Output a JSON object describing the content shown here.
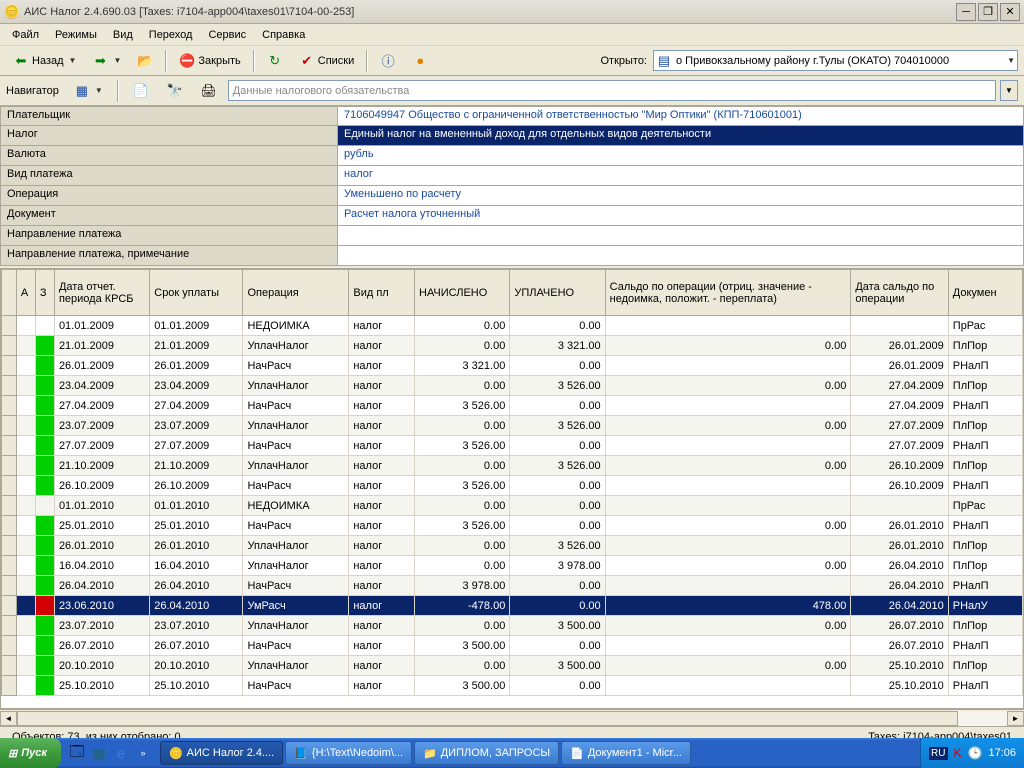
{
  "window": {
    "title": "АИС Налог 2.4.690.03 [Taxes: i7104-app004\\taxes01\\7104-00-253]"
  },
  "menu": [
    "Файл",
    "Режимы",
    "Вид",
    "Переход",
    "Сервис",
    "Справка"
  ],
  "toolbar": {
    "back": "Назад",
    "close": "Закрыть",
    "lists": "Списки",
    "open_label": "Открыто:",
    "open_value": "о Привокзальному району г.Тулы (ОКАТО) 704010000"
  },
  "navigator": {
    "label": "Навигатор",
    "placeholder": "Данные налогового обязательства"
  },
  "form": {
    "rows": [
      {
        "label": "Плательщик",
        "value": "7106049947   Общество с ограниченной ответственностью \"Мир Оптики\" (КПП-710601001)",
        "hl": false
      },
      {
        "label": "Налог",
        "value": "Единый налог на вмененный доход для отдельных видов деятельности",
        "hl": true
      },
      {
        "label": "Валюта",
        "value": "рубль",
        "hl": false
      },
      {
        "label": "Вид платежа",
        "value": "налог",
        "hl": false
      },
      {
        "label": "Операция",
        "value": "Уменьшено по расчету",
        "hl": false
      },
      {
        "label": "Документ",
        "value": "Расчет налога уточненный",
        "hl": false
      }
    ],
    "full_rows": [
      {
        "label": "Направление платежа"
      },
      {
        "label": "Направление платежа, примечание"
      }
    ]
  },
  "grid": {
    "headers": {
      "a": "А",
      "z": "З",
      "date_period": "Дата отчет. периода КРСБ",
      "due_date": "Срок уплаты",
      "operation": "Операция",
      "pay_type": "Вид пл",
      "accrued": "НАЧИСЛЕНО",
      "paid": "УПЛАЧЕНО",
      "balance": "Сальдо по операции (отриц. значение - недоимка, положит. - переплата)",
      "balance_date": "Дата сальдо по операции",
      "doc": "Докумен"
    },
    "rows": [
      {
        "flag": "",
        "d1": "01.01.2009",
        "d2": "01.01.2009",
        "op": "НЕДОИМКА",
        "vp": "налог",
        "acc": "0.00",
        "paid": "0.00",
        "bal": "",
        "bd": "",
        "doc": "ПрРас",
        "sel": false
      },
      {
        "flag": "green",
        "d1": "21.01.2009",
        "d2": "21.01.2009",
        "op": "УплачНалог",
        "vp": "налог",
        "acc": "0.00",
        "paid": "3 321.00",
        "bal": "0.00",
        "bd": "26.01.2009",
        "doc": "ПлПор",
        "sel": false
      },
      {
        "flag": "green",
        "d1": "26.01.2009",
        "d2": "26.01.2009",
        "op": "НачРасч",
        "vp": "налог",
        "acc": "3 321.00",
        "paid": "0.00",
        "bal": "",
        "bd": "26.01.2009",
        "doc": "РНалП",
        "sel": false
      },
      {
        "flag": "green",
        "d1": "23.04.2009",
        "d2": "23.04.2009",
        "op": "УплачНалог",
        "vp": "налог",
        "acc": "0.00",
        "paid": "3 526.00",
        "bal": "0.00",
        "bd": "27.04.2009",
        "doc": "ПлПор",
        "sel": false
      },
      {
        "flag": "green",
        "d1": "27.04.2009",
        "d2": "27.04.2009",
        "op": "НачРасч",
        "vp": "налог",
        "acc": "3 526.00",
        "paid": "0.00",
        "bal": "",
        "bd": "27.04.2009",
        "doc": "РНалП",
        "sel": false
      },
      {
        "flag": "green",
        "d1": "23.07.2009",
        "d2": "23.07.2009",
        "op": "УплачНалог",
        "vp": "налог",
        "acc": "0.00",
        "paid": "3 526.00",
        "bal": "0.00",
        "bd": "27.07.2009",
        "doc": "ПлПор",
        "sel": false
      },
      {
        "flag": "green",
        "d1": "27.07.2009",
        "d2": "27.07.2009",
        "op": "НачРасч",
        "vp": "налог",
        "acc": "3 526.00",
        "paid": "0.00",
        "bal": "",
        "bd": "27.07.2009",
        "doc": "РНалП",
        "sel": false
      },
      {
        "flag": "green",
        "d1": "21.10.2009",
        "d2": "21.10.2009",
        "op": "УплачНалог",
        "vp": "налог",
        "acc": "0.00",
        "paid": "3 526.00",
        "bal": "0.00",
        "bd": "26.10.2009",
        "doc": "ПлПор",
        "sel": false
      },
      {
        "flag": "green",
        "d1": "26.10.2009",
        "d2": "26.10.2009",
        "op": "НачРасч",
        "vp": "налог",
        "acc": "3 526.00",
        "paid": "0.00",
        "bal": "",
        "bd": "26.10.2009",
        "doc": "РНалП",
        "sel": false
      },
      {
        "flag": "",
        "d1": "01.01.2010",
        "d2": "01.01.2010",
        "op": "НЕДОИМКА",
        "vp": "налог",
        "acc": "0.00",
        "paid": "0.00",
        "bal": "",
        "bd": "",
        "doc": "ПрРас",
        "sel": false
      },
      {
        "flag": "green",
        "d1": "25.01.2010",
        "d2": "25.01.2010",
        "op": "НачРасч",
        "vp": "налог",
        "acc": "3 526.00",
        "paid": "0.00",
        "bal": "0.00",
        "bd": "26.01.2010",
        "doc": "РНалП",
        "sel": false
      },
      {
        "flag": "green",
        "d1": "26.01.2010",
        "d2": "26.01.2010",
        "op": "УплачНалог",
        "vp": "налог",
        "acc": "0.00",
        "paid": "3 526.00",
        "bal": "",
        "bd": "26.01.2010",
        "doc": "ПлПор",
        "sel": false
      },
      {
        "flag": "green",
        "d1": "16.04.2010",
        "d2": "16.04.2010",
        "op": "УплачНалог",
        "vp": "налог",
        "acc": "0.00",
        "paid": "3 978.00",
        "bal": "0.00",
        "bd": "26.04.2010",
        "doc": "ПлПор",
        "sel": false
      },
      {
        "flag": "green",
        "d1": "26.04.2010",
        "d2": "26.04.2010",
        "op": "НачРасч",
        "vp": "налог",
        "acc": "3 978.00",
        "paid": "0.00",
        "bal": "",
        "bd": "26.04.2010",
        "doc": "РНалП",
        "sel": false
      },
      {
        "flag": "red",
        "d1": "23.06.2010",
        "d2": "26.04.2010",
        "op": "УмРасч",
        "vp": "налог",
        "acc": "-478.00",
        "paid": "0.00",
        "bal": "478.00",
        "bd": "26.04.2010",
        "doc": "РНалУ",
        "sel": true
      },
      {
        "flag": "green",
        "d1": "23.07.2010",
        "d2": "23.07.2010",
        "op": "УплачНалог",
        "vp": "налог",
        "acc": "0.00",
        "paid": "3 500.00",
        "bal": "0.00",
        "bd": "26.07.2010",
        "doc": "ПлПор",
        "sel": false
      },
      {
        "flag": "green",
        "d1": "26.07.2010",
        "d2": "26.07.2010",
        "op": "НачРасч",
        "vp": "налог",
        "acc": "3 500.00",
        "paid": "0.00",
        "bal": "",
        "bd": "26.07.2010",
        "doc": "РНалП",
        "sel": false
      },
      {
        "flag": "green",
        "d1": "20.10.2010",
        "d2": "20.10.2010",
        "op": "УплачНалог",
        "vp": "налог",
        "acc": "0.00",
        "paid": "3 500.00",
        "bal": "0.00",
        "bd": "25.10.2010",
        "doc": "ПлПор",
        "sel": false
      },
      {
        "flag": "green",
        "d1": "25.10.2010",
        "d2": "25.10.2010",
        "op": "НачРасч",
        "vp": "налог",
        "acc": "3 500.00",
        "paid": "0.00",
        "bal": "",
        "bd": "25.10.2010",
        "doc": "РНалП",
        "sel": false
      }
    ]
  },
  "status": {
    "left": "Объектов: 73, из них отобрано: 0",
    "right": "Taxes: i7104-app004\\taxes01"
  },
  "taskbar": {
    "start": "Пуск",
    "tasks": [
      {
        "label": "АИС Налог 2.4....",
        "active": true,
        "icon": "🪙"
      },
      {
        "label": "{H:\\Text\\Nedoim\\...",
        "active": false,
        "icon": "📘"
      },
      {
        "label": "ДИПЛОМ, ЗАПРОСЫ",
        "active": false,
        "icon": "📁"
      },
      {
        "label": "Документ1 - Micr...",
        "active": false,
        "icon": "📄"
      }
    ],
    "clock": "17:06"
  }
}
